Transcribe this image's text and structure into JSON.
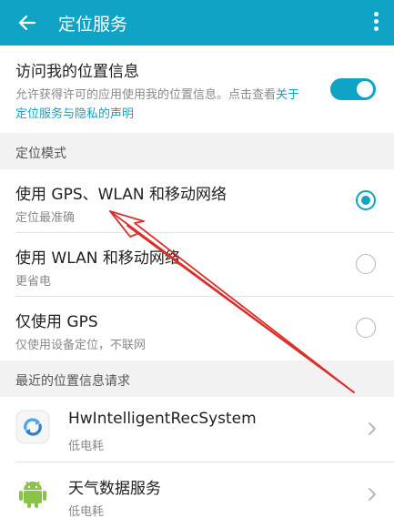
{
  "appbar": {
    "title": "定位服务",
    "back_icon": "arrow-left-icon",
    "menu_icon": "more-vert-icon"
  },
  "access": {
    "title": "访问我的位置信息",
    "desc": "允许获得许可的应用使用我的位置信息。点击查看",
    "link": "关于定位服务与隐私的声明",
    "enabled": true
  },
  "mode_section": {
    "label": "定位模式"
  },
  "modes": [
    {
      "title": "使用 GPS、WLAN 和移动网络",
      "sub": "定位最准确",
      "selected": true
    },
    {
      "title": "使用 WLAN 和移动网络",
      "sub": "更省电",
      "selected": false
    },
    {
      "title": "仅使用 GPS",
      "sub": "仅使用设备定位，不联网",
      "selected": false
    }
  ],
  "recent_section": {
    "label": "最近的位置信息请求"
  },
  "recent_apps": [
    {
      "name": "HwIntelligentRecSystem",
      "sub": "低电耗",
      "icon": "hw-rec-system-icon"
    },
    {
      "name": "天气数据服务",
      "sub": "低电耗",
      "icon": "android-icon"
    }
  ],
  "colors": {
    "accent": "#0fa3c6",
    "annotation": "#d9302c"
  }
}
